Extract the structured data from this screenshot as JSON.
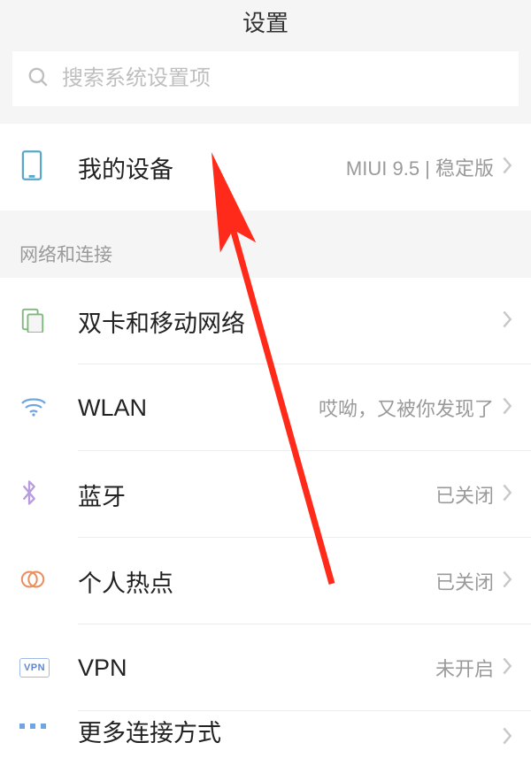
{
  "header": {
    "title": "设置"
  },
  "search": {
    "placeholder": "搜索系统设置项"
  },
  "device_section": {
    "my_device": {
      "label": "我的设备",
      "value": "MIUI 9.5 | 稳定版"
    }
  },
  "network_section": {
    "header": "网络和连接",
    "dual_sim": {
      "label": "双卡和移动网络"
    },
    "wlan": {
      "label": "WLAN",
      "value": "哎呦，又被你发现了"
    },
    "bluetooth": {
      "label": "蓝牙",
      "value": "已关闭"
    },
    "hotspot": {
      "label": "个人热点",
      "value": "已关闭"
    },
    "vpn": {
      "label": "VPN",
      "value": "未开启",
      "badge": "VPN"
    },
    "more": {
      "label": "更多连接方式"
    }
  }
}
